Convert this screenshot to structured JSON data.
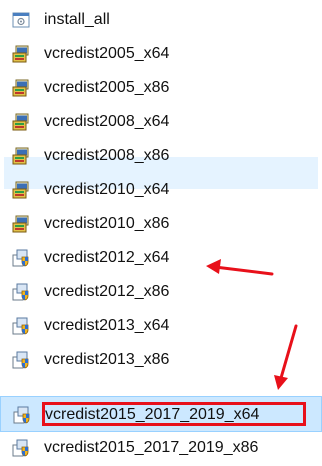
{
  "files": [
    {
      "name": "install_all",
      "icon": "batch-file-icon"
    },
    {
      "name": "vcredist2005_x64",
      "icon": "installer-package-icon"
    },
    {
      "name": "vcredist2005_x86",
      "icon": "installer-package-icon"
    },
    {
      "name": "vcredist2008_x64",
      "icon": "installer-package-icon"
    },
    {
      "name": "vcredist2008_x86",
      "icon": "installer-package-icon"
    },
    {
      "name": "vcredist2010_x64",
      "icon": "installer-package-icon"
    },
    {
      "name": "vcredist2010_x86",
      "icon": "installer-package-icon"
    },
    {
      "name": "vcredist2012_x64",
      "icon": "setup-shield-icon"
    },
    {
      "name": "vcredist2012_x86",
      "icon": "setup-shield-icon"
    },
    {
      "name": "vcredist2013_x64",
      "icon": "setup-shield-icon"
    },
    {
      "name": "vcredist2013_x86",
      "icon": "setup-shield-icon"
    },
    {
      "name": "vcredist2015_2017_2019_x64",
      "icon": "setup-shield-icon"
    },
    {
      "name": "vcredist2015_2017_2019_x86",
      "icon": "setup-shield-icon"
    }
  ],
  "annotations": {
    "highlight_color": "#e8101a",
    "selection_color": "#cce8ff",
    "arrow_targets": [
      "vcredist2012_x64",
      "vcredist2015_2017_2019_x64"
    ]
  }
}
